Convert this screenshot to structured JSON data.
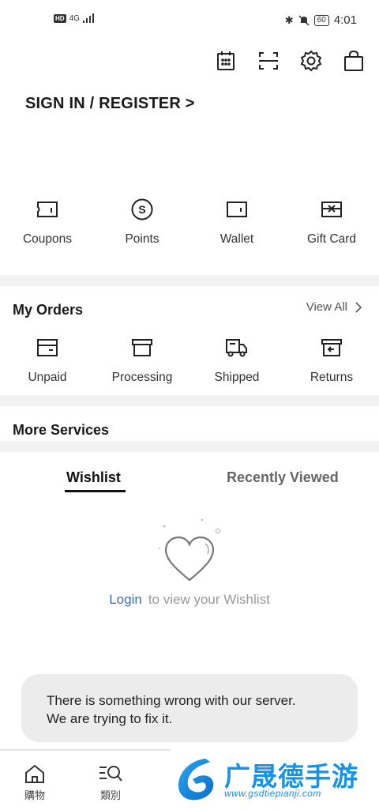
{
  "status_bar": {
    "hd": "HD",
    "network": "4G",
    "battery": "60",
    "time": "4:01"
  },
  "header": {
    "icons": [
      "calendar-icon",
      "scan-icon",
      "settings-icon",
      "bag-icon"
    ],
    "sign_in": "SIGN IN / REGISTER >"
  },
  "assets": [
    {
      "label": "Coupons",
      "icon": "coupon-icon"
    },
    {
      "label": "Points",
      "icon": "points-icon"
    },
    {
      "label": "Wallet",
      "icon": "wallet-icon"
    },
    {
      "label": "Gift Card",
      "icon": "gift-card-icon"
    }
  ],
  "orders": {
    "title": "My Orders",
    "view_all": "View All",
    "items": [
      {
        "label": "Unpaid",
        "icon": "unpaid-icon"
      },
      {
        "label": "Processing",
        "icon": "processing-icon"
      },
      {
        "label": "Shipped",
        "icon": "truck-icon"
      },
      {
        "label": "Returns",
        "icon": "returns-icon"
      }
    ]
  },
  "more_services": {
    "title": "More Services"
  },
  "tabs": [
    {
      "label": "Wishlist",
      "active": true
    },
    {
      "label": "Recently Viewed",
      "active": false
    }
  ],
  "wishlist": {
    "login_link": "Login",
    "login_text": "to view your Wishlist"
  },
  "toast": {
    "line1": "There is something wrong with our server.",
    "line2": "We are trying to fix it."
  },
  "bottom_nav": [
    {
      "label": "購物",
      "icon": "home-icon"
    },
    {
      "label": "類別",
      "icon": "category-search-icon"
    }
  ],
  "watermark": {
    "text": "广晟德手游",
    "url": "www.gsdtiepianji.com"
  }
}
